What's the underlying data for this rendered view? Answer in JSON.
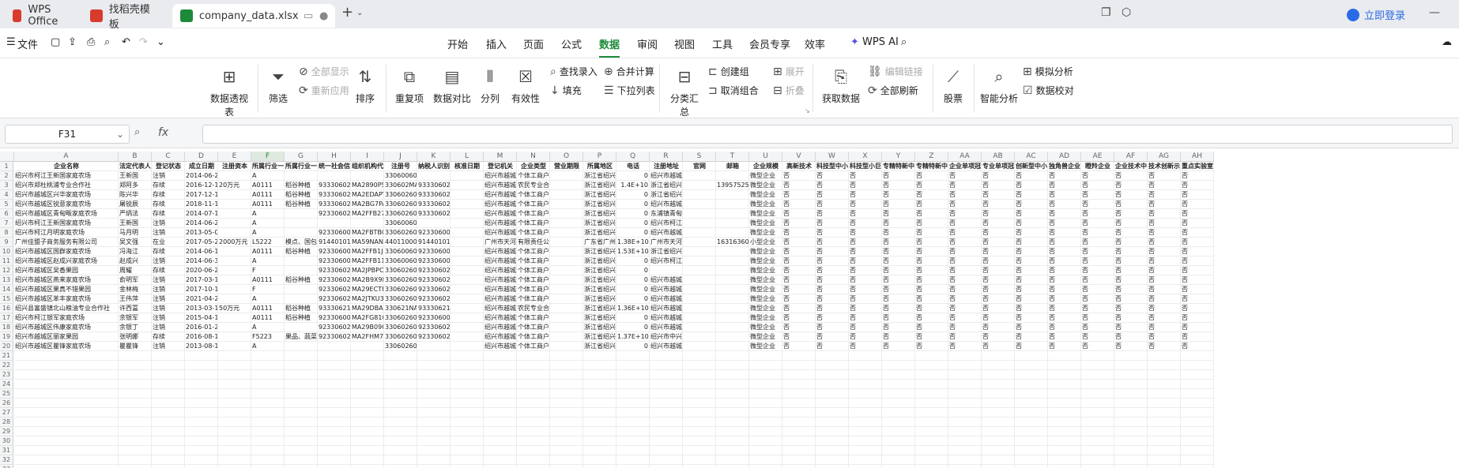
{
  "tabs": [
    {
      "label": "WPS Office",
      "color": "#d83b2c"
    },
    {
      "label": "找稻壳模板",
      "color": "#d83b2c"
    },
    {
      "label": "company_data.xlsx",
      "color": "#1d8a3a"
    }
  ],
  "login": "立即登录",
  "file_menu": "文件",
  "menu": [
    "开始",
    "插入",
    "页面",
    "公式",
    "数据",
    "审阅",
    "视图",
    "工具",
    "会员专享",
    "效率"
  ],
  "active_menu": "数据",
  "wps_ai": "WPS AI",
  "ribbon": {
    "pivot": "数据透视表",
    "filter": "筛选",
    "show_all": "全部显示",
    "reapply": "重新应用",
    "sort": "排序",
    "duplicates": "重复项",
    "compare": "数据对比",
    "split": "分列",
    "validity": "有效性",
    "lookup": "查找录入",
    "fill": "填充",
    "merge_calc": "合并计算",
    "dropdown": "下拉列表",
    "subtotal": "分类汇总",
    "group": "创建组",
    "ungroup": "取消组合",
    "expand": "展开",
    "collapse": "折叠",
    "get_data": "获取数据",
    "edit_links": "编辑链接",
    "refresh_all": "全部刷新",
    "stocks": "股票",
    "smart_analysis": "智能分析",
    "simulate": "模拟分析",
    "verify": "数据校对"
  },
  "name_box": "F31",
  "fx": "fx",
  "columns": [
    "A",
    "B",
    "C",
    "D",
    "E",
    "F",
    "G",
    "H",
    "I",
    "J",
    "K",
    "L",
    "M",
    "N",
    "O",
    "P",
    "Q",
    "R",
    "S",
    "T",
    "U",
    "V",
    "W",
    "X",
    "Y",
    "Z",
    "AA",
    "AB",
    "AC",
    "AD",
    "AE",
    "AF",
    "AG",
    "AH"
  ],
  "selected_column": "F",
  "headers": [
    "企业名称",
    "法定代表人",
    "登记状态",
    "成立日期",
    "注册资本",
    "所属行业一级",
    "所属行业一中",
    "统一社会信用",
    "组织机构代",
    "注册号",
    "纳税人识别",
    "核准日期",
    "登记机关",
    "企业类型",
    "营业期限",
    "所属地区",
    "电话",
    "注册地址",
    "官网",
    "邮箱",
    "企业规模",
    "高新技术",
    "科技型中小",
    "科技型小巨",
    "专精特新中",
    "专精特新中",
    "企业单项冠",
    "专业单项冠",
    "创新型中小",
    "独角兽企业",
    "瞪羚企业",
    "企业技术中",
    "技术创新示",
    "重点实验室"
  ],
  "rows": [
    [
      "绍兴市柯江王新国家庭农场",
      "王新国",
      "注销",
      "2014-06-26",
      "",
      "A",
      "",
      "",
      "",
      "33060060289",
      "",
      "",
      "绍兴市越城",
      "个体工商户",
      "",
      "浙江省绍兴",
      "0",
      "绍兴市越城",
      "",
      "",
      "微型企业",
      "否",
      "否",
      "否",
      "否",
      "否",
      "否",
      "否",
      "否",
      "否",
      "否",
      "否",
      "否",
      "否"
    ],
    [
      "绍兴市郑杜桃浦专业合作社",
      "郑阿多",
      "存续",
      "2016-12-14",
      "20万元",
      "A0111",
      "稻谷种植",
      "93330602MA",
      "MA2890P5-",
      "330602MA0C",
      "93330602MA",
      "",
      "绍兴市越城",
      "农民专业合作社",
      "",
      "浙江省绍兴",
      "1.4E+10",
      "浙江省绍兴",
      "",
      "13957525894",
      "微型企业",
      "否",
      "否",
      "否",
      "否",
      "否",
      "否",
      "否",
      "否",
      "否",
      "否",
      "否",
      "否",
      "否"
    ],
    [
      "绍兴市越城区兴华家庭农场",
      "陈兴华",
      "存续",
      "2017-12-18",
      "",
      "A0111",
      "稻谷种植",
      "93330602MA",
      "MA2EDAPY-",
      "330602607576",
      "93330602MA",
      "",
      "绍兴市越城",
      "个体工商户",
      "",
      "浙江省绍兴",
      "0",
      "浙江省绍兴",
      "",
      "",
      "微型企业",
      "否",
      "否",
      "否",
      "否",
      "否",
      "否",
      "否",
      "否",
      "否",
      "否",
      "否",
      "否",
      "否"
    ],
    [
      "绍兴市越城区锐意家庭农场",
      "屠锐辰",
      "存续",
      "2018-11-16",
      "",
      "A0111",
      "稻谷种植",
      "93330602MA",
      "MA2BG7PA-",
      "330602607576",
      "93330602MA",
      "",
      "绍兴市越城",
      "个体工商户",
      "",
      "浙江省绍兴",
      "0",
      "绍兴市越城",
      "",
      "",
      "微型企业",
      "否",
      "否",
      "否",
      "否",
      "否",
      "否",
      "否",
      "否",
      "否",
      "否",
      "否",
      "否",
      "否"
    ],
    [
      "绍兴市越城区青甸畈家庭农场",
      "严炳法",
      "存续",
      "2014-07-18",
      "",
      "A",
      "",
      "92330602MA",
      "MA2FFB27-",
      "330602603576",
      "93330602MA",
      "",
      "绍兴市越城",
      "个体工商户",
      "",
      "浙江省绍兴",
      "0",
      "东浦镇青甸",
      "",
      "",
      "微型企业",
      "否",
      "否",
      "否",
      "否",
      "否",
      "否",
      "否",
      "否",
      "否",
      "否",
      "否",
      "否",
      "否"
    ],
    [
      "绍兴市柯江王新国家庭农场",
      "王新国",
      "注销",
      "2014-06-26",
      "",
      "A",
      "",
      "",
      "",
      "33060060288",
      "",
      "",
      "绍兴市越城",
      "个体工商户",
      "",
      "浙江省绍兴",
      "0",
      "绍兴市柯江",
      "",
      "",
      "微型企业",
      "否",
      "否",
      "否",
      "否",
      "否",
      "否",
      "否",
      "否",
      "否",
      "否",
      "否",
      "否",
      "否"
    ],
    [
      "绍兴市柯江月明家庭农场",
      "马月明",
      "注销",
      "2013-05-09",
      "",
      "A",
      "",
      "92330600MA",
      "MA2FBTBQ-",
      "330602602042",
      "92330600MA",
      "",
      "绍兴市越城",
      "个体工商户",
      "",
      "浙江省绍兴",
      "0",
      "绍兴市越城",
      "",
      "",
      "微型企业",
      "否",
      "否",
      "否",
      "否",
      "否",
      "否",
      "否",
      "否",
      "否",
      "否",
      "否",
      "否",
      "否"
    ],
    [
      "广州佳盟子商务服务有限公司",
      "吴文强",
      "在业",
      "2017-05-26",
      "2000万元",
      "L5222",
      "模点、国包",
      "91440101MA",
      "MA59NAND-",
      "440110000576",
      "91440101MA",
      "",
      "广州市天河",
      "有限责任公司",
      "",
      "广东省广州",
      "1.38E+10",
      "广州市天河",
      "",
      "16316360163",
      "小型企业",
      "否",
      "否",
      "否",
      "否",
      "否",
      "否",
      "否",
      "否",
      "否",
      "否",
      "否",
      "否",
      "否"
    ],
    [
      "绍兴市越城区国群家庭农场",
      "冯海江",
      "存续",
      "2014-06-10",
      "",
      "A0111",
      "稻谷种植",
      "92330600MA",
      "MA2FFB1J-",
      "330600602042",
      "92330600MA",
      "",
      "绍兴市越城",
      "个体工商户",
      "",
      "浙江省绍兴",
      "1.53E+10",
      "浙江省绍兴",
      "",
      "",
      "微型企业",
      "否",
      "否",
      "否",
      "否",
      "否",
      "否",
      "否",
      "否",
      "否",
      "否",
      "否",
      "否",
      "否"
    ],
    [
      "绍兴市越城区赵成兴家庭农场",
      "赵成兴",
      "注销",
      "2014-06-30",
      "",
      "A",
      "",
      "92330600MA",
      "MA2FFB11-",
      "330600602042",
      "92330600MA",
      "",
      "绍兴市越城",
      "个体工商户",
      "",
      "浙江省绍兴",
      "0",
      "绍兴市柯江",
      "",
      "",
      "微型企业",
      "否",
      "否",
      "否",
      "否",
      "否",
      "否",
      "否",
      "否",
      "否",
      "否",
      "否",
      "否",
      "否"
    ],
    [
      "绍兴市越城区吴香果园",
      "周耀",
      "存续",
      "2020-06-22",
      "",
      "F",
      "",
      "92330602MA",
      "MA2JPBPC-",
      "330602609781",
      "92330602MA",
      "",
      "绍兴市越城",
      "个体工商户",
      "",
      "浙江省绍兴",
      "0",
      "",
      "",
      "",
      "微型企业",
      "否",
      "否",
      "否",
      "否",
      "否",
      "否",
      "否",
      "否",
      "否",
      "否",
      "否",
      "否",
      "否"
    ],
    [
      "绍兴市越城区燕来家庭农场",
      "俞明军",
      "注销",
      "2017-03-15",
      "",
      "A0111",
      "稻谷种植",
      "92330602MA",
      "MA2B9X9R-",
      "330602605902",
      "92330602MA",
      "",
      "绍兴市越城",
      "个体工商户",
      "",
      "浙江省绍兴",
      "0",
      "绍兴市越城",
      "",
      "",
      "微型企业",
      "否",
      "否",
      "否",
      "否",
      "否",
      "否",
      "否",
      "否",
      "否",
      "否",
      "否",
      "否",
      "否"
    ],
    [
      "绍兴市越城区果真不错果园",
      "金林梅",
      "注销",
      "2017-10-19",
      "",
      "F",
      "",
      "92330602MA",
      "MA29ECTH-",
      "330602606987",
      "92330602MA",
      "",
      "绍兴市越城",
      "个体工商户",
      "",
      "浙江省绍兴",
      "0",
      "绍兴市越城",
      "",
      "",
      "微型企业",
      "否",
      "否",
      "否",
      "否",
      "否",
      "否",
      "否",
      "否",
      "否",
      "否",
      "否",
      "否",
      "否"
    ],
    [
      "绍兴市越城区苯丰家庭农场",
      "王伟萍",
      "注销",
      "2021-04-27",
      "",
      "A",
      "",
      "92330602MA",
      "MA2JTKU3-",
      "330602609781",
      "92330602MA",
      "",
      "绍兴市越城",
      "个体工商户",
      "",
      "浙江省绍兴",
      "0",
      "绍兴市越城",
      "",
      "",
      "微型企业",
      "否",
      "否",
      "否",
      "否",
      "否",
      "否",
      "否",
      "否",
      "否",
      "否",
      "否",
      "否",
      "否"
    ],
    [
      "绍兴县富盛镇北山粮油专业合作社",
      "许西冨",
      "注销",
      "2013-03-19",
      "50万元",
      "A0111",
      "稻谷种植",
      "93330621MA",
      "MA29DBAH-",
      "330621NA000",
      "93330621MA",
      "",
      "绍兴市越城",
      "农民专业合作社",
      "",
      "浙江省绍兴",
      "1.36E+10",
      "绍兴市越城",
      "",
      "",
      "微型企业",
      "否",
      "否",
      "否",
      "否",
      "否",
      "否",
      "否",
      "否",
      "否",
      "否",
      "否",
      "否",
      "否"
    ],
    [
      "绍兴市柯江银军家庭农场",
      "余银军",
      "注销",
      "2015-04-13",
      "",
      "A0111",
      "稻谷种植",
      "92330600MA",
      "MA2FG810-",
      "330602602042",
      "92330600MA",
      "",
      "绍兴市越城",
      "个体工商户",
      "",
      "浙江省绍兴",
      "0",
      "绍兴市越城",
      "",
      "",
      "微型企业",
      "否",
      "否",
      "否",
      "否",
      "否",
      "否",
      "否",
      "否",
      "否",
      "否",
      "否",
      "否",
      "否"
    ],
    [
      "绍兴市越城区伟康家庭农场",
      "余银丁",
      "注销",
      "2016-01-21",
      "",
      "A",
      "",
      "92330602MA",
      "MA29B090-",
      "330602603945",
      "92330602MA",
      "",
      "绍兴市越城",
      "个体工商户",
      "",
      "浙江省绍兴",
      "0",
      "绍兴市越城",
      "",
      "",
      "微型企业",
      "否",
      "否",
      "否",
      "否",
      "否",
      "否",
      "否",
      "否",
      "否",
      "否",
      "否",
      "否",
      "否"
    ],
    [
      "绍兴市越城区丽家果园",
      "张明娜",
      "存续",
      "2016-08-11",
      "",
      "F5223",
      "果品、蔬菜",
      "92330602MA",
      "MA2FHM7K-",
      "330602604467",
      "92330602MA",
      "",
      "绍兴市越城",
      "个体工商户",
      "",
      "浙江省绍兴",
      "1.37E+10",
      "绍兴市中兴",
      "",
      "",
      "微型企业",
      "否",
      "否",
      "否",
      "否",
      "否",
      "否",
      "否",
      "否",
      "否",
      "否",
      "否",
      "否",
      "否"
    ],
    [
      "绍兴市越城区瞿锋家庭农场",
      "瞿瞿锋",
      "注销",
      "2013-08-12",
      "",
      "A",
      "",
      "",
      "",
      "33060260101",
      "",
      "",
      "绍兴市越城",
      "个体工商户",
      "",
      "浙江省绍兴",
      "0",
      "绍兴市越城",
      "",
      "",
      "微型企业",
      "否",
      "否",
      "否",
      "否",
      "否",
      "否",
      "否",
      "否",
      "否",
      "否",
      "否",
      "否",
      "否"
    ]
  ]
}
